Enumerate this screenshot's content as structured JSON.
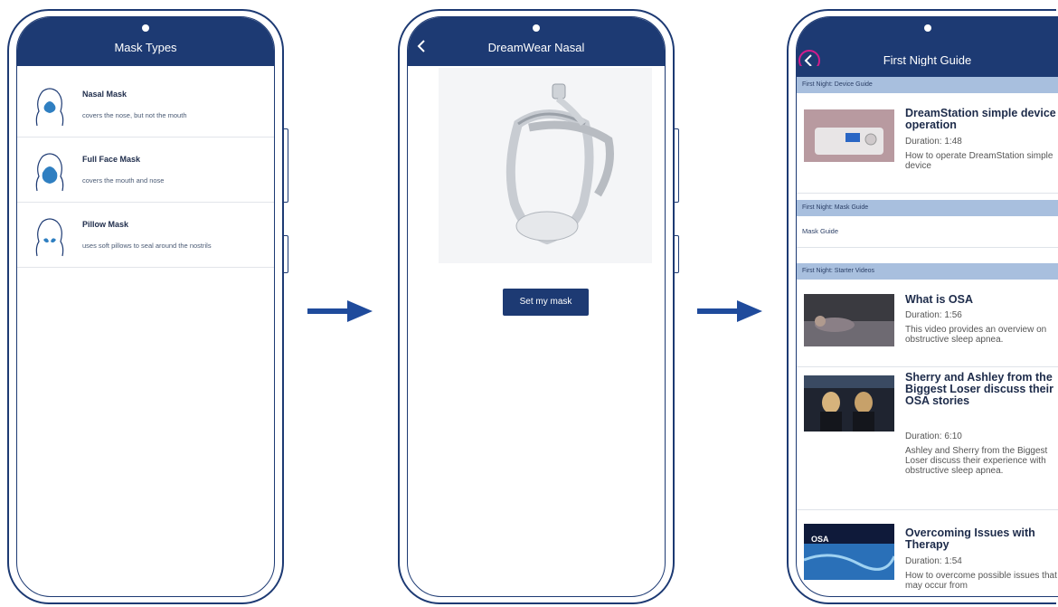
{
  "screen1": {
    "title": "Mask Types",
    "items": [
      {
        "name": "Nasal Mask",
        "desc": "covers the nose, but not the mouth"
      },
      {
        "name": "Full Face Mask",
        "desc": "covers the mouth and nose"
      },
      {
        "name": "Pillow Mask",
        "desc": "uses soft pillows to seal around the nostrils"
      }
    ]
  },
  "screen2": {
    "title": "DreamWear Nasal",
    "button": "Set my mask"
  },
  "screen3": {
    "title": "First Night Guide",
    "sections": [
      {
        "label": "First Night: Device Guide"
      },
      {
        "label": "First Night: Mask Guide"
      },
      {
        "label": "First Night: Starter Videos"
      }
    ],
    "device_video": {
      "title": "DreamStation simple device operation",
      "duration": "Duration: 1:48",
      "desc": "How to operate DreamStation simple device"
    },
    "mask_guide_label": "Mask Guide",
    "videos": [
      {
        "title": "What is OSA",
        "duration": "Duration: 1:56",
        "desc": "This video provides an overview on obstructive sleep apnea."
      },
      {
        "title": "Sherry and Ashley from the Biggest Loser discuss their OSA stories",
        "duration": "Duration: 6:10",
        "desc": "Ashley and Sherry from the Biggest Loser discuss their experience with obstructive sleep apnea."
      },
      {
        "title": "Overcoming Issues with Therapy",
        "duration": "Duration: 1:54",
        "desc": "How to overcome possible issues that may occur from"
      }
    ],
    "thumb_label": "OSA"
  },
  "colors": {
    "header": "#1d3a73",
    "section": "#a8bfde",
    "highlight": "#d21c8c",
    "mask_blue": "#2f7fc1"
  }
}
